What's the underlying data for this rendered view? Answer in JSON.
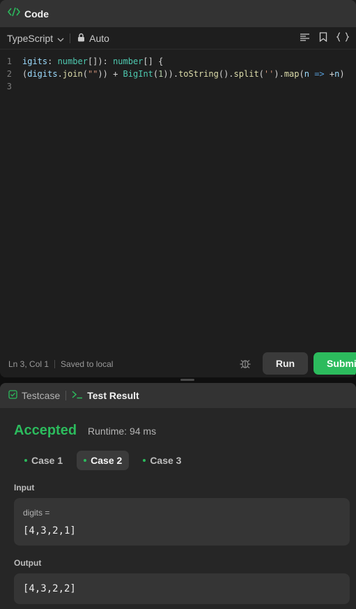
{
  "code_panel": {
    "title": "Code",
    "language": "TypeScript",
    "mode": "Auto",
    "lines": [
      {
        "n": "1",
        "tokens": [
          {
            "t": "igits",
            "c": "tk-id"
          },
          {
            "t": ": ",
            "c": "tk-op"
          },
          {
            "t": "number",
            "c": "tk-type"
          },
          {
            "t": "[]): ",
            "c": "tk-op"
          },
          {
            "t": "number",
            "c": "tk-type"
          },
          {
            "t": "[] {",
            "c": "tk-op"
          }
        ]
      },
      {
        "n": "2",
        "tokens": [
          {
            "t": "(",
            "c": "tk-op"
          },
          {
            "t": "digits",
            "c": "tk-id"
          },
          {
            "t": ".",
            "c": "tk-op"
          },
          {
            "t": "join",
            "c": "tk-fn"
          },
          {
            "t": "(",
            "c": "tk-op"
          },
          {
            "t": "\"\"",
            "c": "tk-str"
          },
          {
            "t": ")) + ",
            "c": "tk-op"
          },
          {
            "t": "BigInt",
            "c": "tk-type"
          },
          {
            "t": "(",
            "c": "tk-op"
          },
          {
            "t": "1",
            "c": "tk-num"
          },
          {
            "t": ")).",
            "c": "tk-op"
          },
          {
            "t": "toString",
            "c": "tk-fn"
          },
          {
            "t": "().",
            "c": "tk-op"
          },
          {
            "t": "split",
            "c": "tk-fn"
          },
          {
            "t": "(",
            "c": "tk-op"
          },
          {
            "t": "''",
            "c": "tk-str"
          },
          {
            "t": ").",
            "c": "tk-op"
          },
          {
            "t": "map",
            "c": "tk-fn"
          },
          {
            "t": "(",
            "c": "tk-op"
          },
          {
            "t": "n",
            "c": "tk-id"
          },
          {
            "t": " => ",
            "c": "tk-kw"
          },
          {
            "t": "+",
            "c": "tk-op"
          },
          {
            "t": "n",
            "c": "tk-id"
          },
          {
            "t": ")",
            "c": "tk-op"
          }
        ]
      },
      {
        "n": "3",
        "tokens": []
      }
    ],
    "status": {
      "cursor": "Ln 3, Col 1",
      "save_state": "Saved to local"
    },
    "run_label": "Run",
    "submit_label": "Submit"
  },
  "result_panel": {
    "tab_testcase": "Testcase",
    "tab_result": "Test Result",
    "verdict": "Accepted",
    "runtime": "Runtime: 94 ms",
    "cases": [
      "Case 1",
      "Case 2",
      "Case 3"
    ],
    "active_case": 1,
    "input_label": "Input",
    "input_var": "digits =",
    "input_value": "[4,3,2,1]",
    "output_label": "Output",
    "output_value": "[4,3,2,2]"
  },
  "colors": {
    "accent": "#2cbb5d",
    "panel": "#1e1e1e",
    "header": "#333333"
  }
}
